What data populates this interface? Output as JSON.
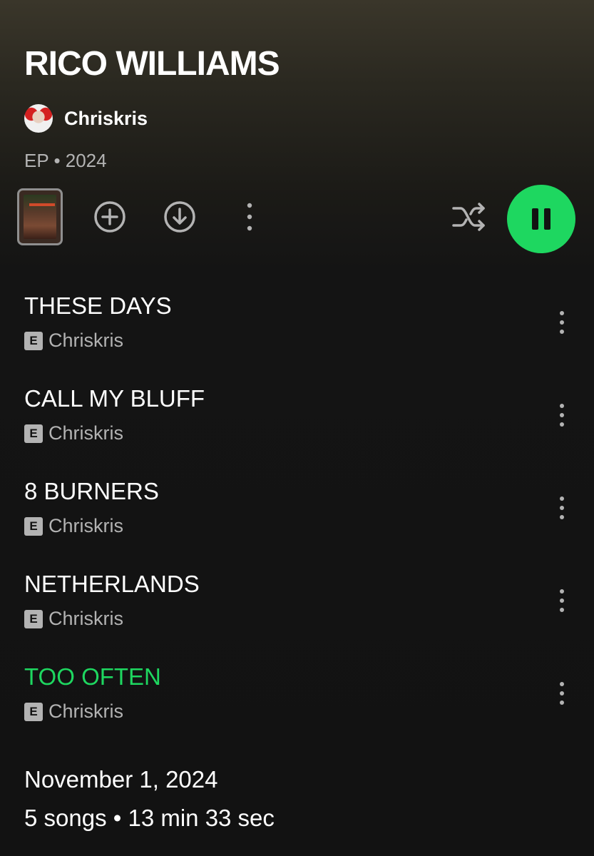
{
  "album": {
    "title": "RICO WILLIAMS",
    "artist": "Chriskris",
    "type": "EP",
    "separator": "•",
    "year": "2024",
    "meta": "EP • 2024"
  },
  "controls": {
    "cover_icon": "album-cover-thumbnail",
    "add_icon": "add-circle-icon",
    "download_icon": "download-circle-icon",
    "more_icon": "more-vertical-icon",
    "shuffle_icon": "shuffle-icon",
    "play_state_icon": "pause-icon"
  },
  "colors": {
    "accent": "#1ed760",
    "background": "#121212",
    "secondary_text": "#b3b3b3"
  },
  "tracks": [
    {
      "title": "THESE DAYS",
      "explicit": "E",
      "artist": "Chriskris",
      "playing": false
    },
    {
      "title": "CALL MY BLUFF",
      "explicit": "E",
      "artist": "Chriskris",
      "playing": false
    },
    {
      "title": "8 BURNERS",
      "explicit": "E",
      "artist": "Chriskris",
      "playing": false
    },
    {
      "title": "NETHERLANDS",
      "explicit": "E",
      "artist": "Chriskris",
      "playing": false
    },
    {
      "title": "TOO OFTEN",
      "explicit": "E",
      "artist": "Chriskris",
      "playing": true
    }
  ],
  "footer": {
    "release_date": "November 1, 2024",
    "summary": "5 songs • 13 min 33 sec"
  }
}
